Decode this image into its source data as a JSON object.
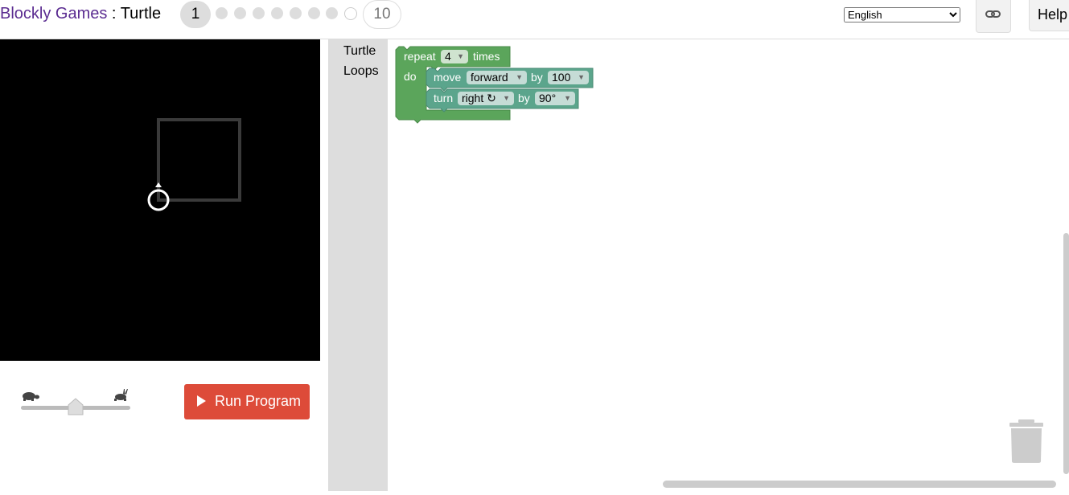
{
  "header": {
    "brand": "Blockly Games",
    "separator": " : ",
    "game": "Turtle",
    "levels": {
      "current": "1",
      "last": "10"
    },
    "language": "English",
    "help_label": "Help"
  },
  "toolbox": {
    "categories": [
      "Turtle",
      "Loops"
    ]
  },
  "blocks": {
    "repeat": {
      "label": "repeat",
      "count": "4",
      "times": "times",
      "do": "do"
    },
    "move": {
      "label": "move",
      "direction": "forward",
      "by": "by",
      "amount": "100"
    },
    "turn": {
      "label": "turn",
      "direction": "right ↻",
      "by": "by",
      "angle": "90°"
    }
  },
  "controls": {
    "run_label": "Run Program"
  },
  "colors": {
    "brand": "#5b2c91",
    "loop_block": "#5ba55b",
    "turtle_block": "#5ba58c",
    "run_button": "#dd4b39"
  }
}
